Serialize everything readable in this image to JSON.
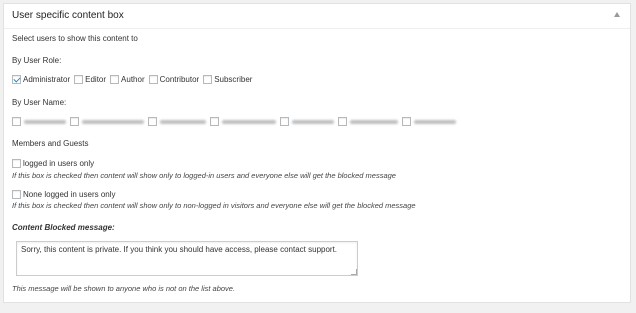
{
  "box": {
    "title": "User specific content box",
    "intro": "Select users to show this content to",
    "by_role_heading": "By User Role:",
    "roles": [
      {
        "label": "Administrator",
        "checked": true
      },
      {
        "label": "Editor",
        "checked": false
      },
      {
        "label": "Author",
        "checked": false
      },
      {
        "label": "Contributor",
        "checked": false
      },
      {
        "label": "Subscriber",
        "checked": false
      }
    ],
    "by_name_heading": "By User Name:",
    "members_heading": "Members and Guests",
    "logged_in": {
      "label": "logged in users only",
      "note": "If this box is checked then content will show only to logged-in users and everyone else will get the blocked message"
    },
    "none_logged": {
      "label": "None logged in users only",
      "note": "If this box is checked then content will show only to non-logged in visitors and everyone else will get the blocked message"
    },
    "blocked_heading": "Content Blocked message:",
    "blocked_message": "Sorry, this content is private. If you think you should have access, please contact support.",
    "footer_note": "This message will be shown to anyone who is not on the list above."
  }
}
